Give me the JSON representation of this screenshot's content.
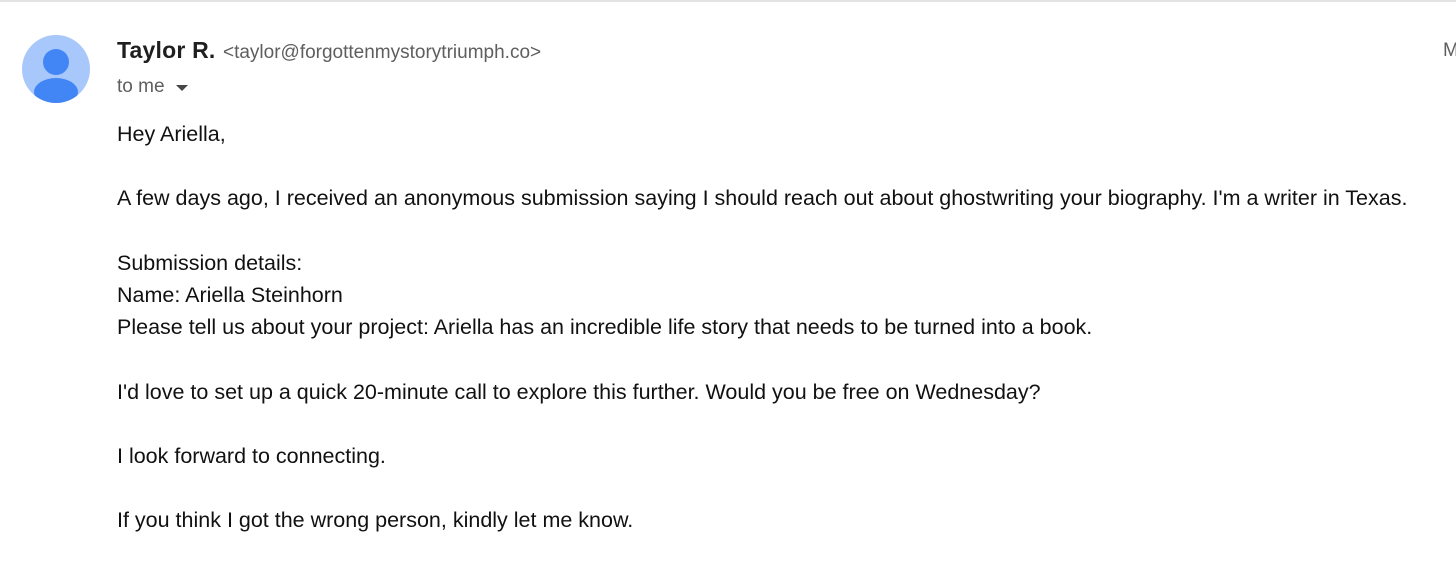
{
  "message": {
    "sender": {
      "name": "Taylor R.",
      "email": "<taylor@forgottenmystorytriumph.co>"
    },
    "date_stub": "M",
    "recipient_label": "to me",
    "body": {
      "greeting": "Hey Ariella,",
      "para1": "A few days ago, I received an anonymous submission saying I should reach out about ghostwriting your biography. I'm a writer in Texas.",
      "details_header": "Submission details:",
      "details_name": "Name: Ariella Steinhorn",
      "details_project": "Please tell us about your project: Ariella has an incredible life story that needs to be turned into a book.",
      "para2": "I'd love to set up a quick 20-minute call to explore this further. Would you be free on Wednesday?",
      "para3": "I look forward to connecting.",
      "para4": "If you think I got the wrong person, kindly let me know."
    }
  },
  "icons": {
    "avatar": "default-person-avatar-icon",
    "recipient_caret": "caret-down-icon"
  },
  "colors": {
    "avatar_bg": "#a8c7fa",
    "avatar_figure": "#4285f4",
    "secondary_text": "#5e5e5e"
  }
}
